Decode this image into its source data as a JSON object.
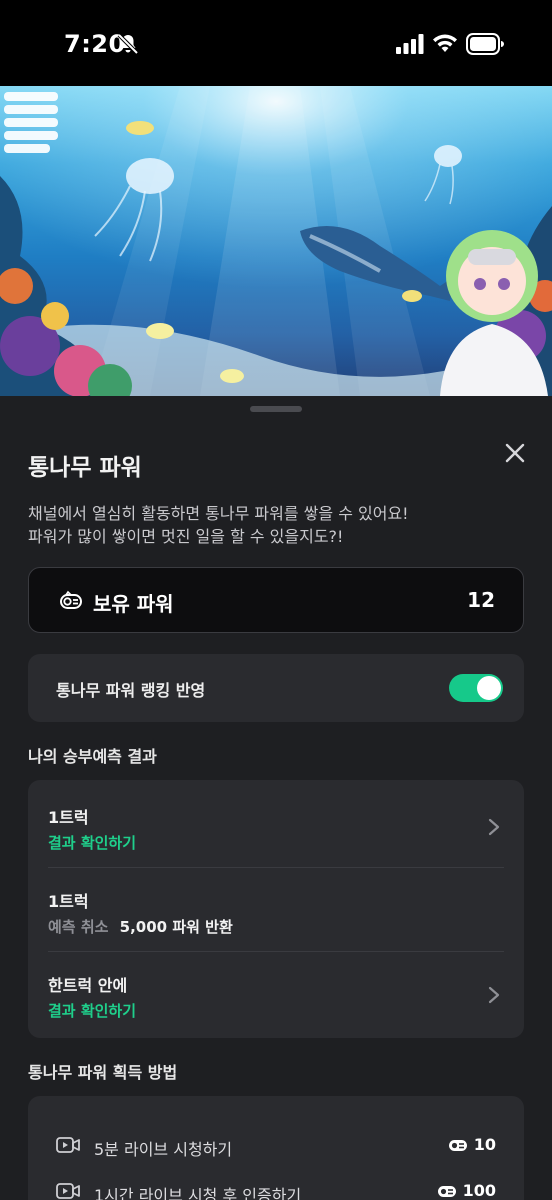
{
  "status_bar": {
    "time": "7:20"
  },
  "sheet": {
    "title": "통나무 파워",
    "description_line1": "채널에서 열심히 활동하면 통나무 파워를 쌓을 수 있어요!",
    "description_line2": "파워가 많이 쌓이면 멋진 일을 할 수 있을지도?!",
    "owned_power": {
      "label": "보유 파워",
      "value": "12"
    },
    "ranking_toggle": {
      "label": "통나무 파워 랭킹 반영",
      "on": true,
      "accent": "#16c98a"
    },
    "predictions": {
      "section_title": "나의 승부예측 결과",
      "items": [
        {
          "name": "1트럭",
          "action": "결과 확인하기"
        },
        {
          "name": "1트럭",
          "status": "예측 취소",
          "detail": "5,000 파워 반환"
        },
        {
          "name": "한트럭 안에",
          "action": "결과 확인하기"
        }
      ]
    },
    "earn": {
      "section_title": "통나무 파워 획득 방법",
      "items": [
        {
          "label": "5분 라이브 시청하기",
          "points": "10"
        },
        {
          "label": "1시간 라이브 시청 후 인증하기",
          "points": "100"
        }
      ]
    }
  },
  "colors": {
    "accent_green": "#1fcf8b",
    "sheet_bg": "#1e1f22",
    "card_bg": "#2a2b2f"
  }
}
